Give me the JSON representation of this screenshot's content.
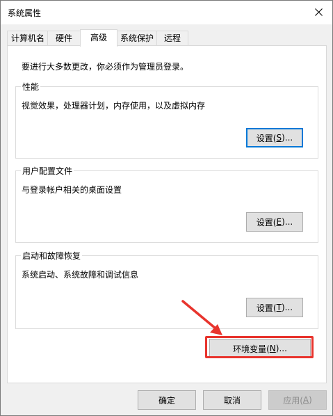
{
  "window": {
    "title": "系统属性"
  },
  "tabs": [
    {
      "label": "计算机名"
    },
    {
      "label": "硬件"
    },
    {
      "label": "高级"
    },
    {
      "label": "系统保护"
    },
    {
      "label": "远程"
    }
  ],
  "active_tab": "高级",
  "intro_text": "要进行大多数更改，你必须作为管理员登录。",
  "groups": {
    "performance": {
      "title": "性能",
      "description": "视觉效果，处理器计划，内存使用，以及虚拟内存",
      "button_prefix": "设置(",
      "button_key": "S",
      "button_suffix": ")..."
    },
    "user_profiles": {
      "title": "用户配置文件",
      "description": "与登录帐户相关的桌面设置",
      "button_prefix": "设置(",
      "button_key": "E",
      "button_suffix": ")..."
    },
    "startup_recovery": {
      "title": "启动和故障恢复",
      "description": "系统启动、系统故障和调试信息",
      "button_prefix": "设置(",
      "button_key": "T",
      "button_suffix": ")..."
    }
  },
  "env_button": {
    "prefix": "环境变量(",
    "key": "N",
    "suffix": ")..."
  },
  "footer": {
    "ok": "确定",
    "cancel": "取消",
    "apply_prefix": "应用(",
    "apply_key": "A",
    "apply_suffix": ")"
  },
  "colors": {
    "focus_border": "#0078d7",
    "annotation_red": "#e8342d"
  }
}
